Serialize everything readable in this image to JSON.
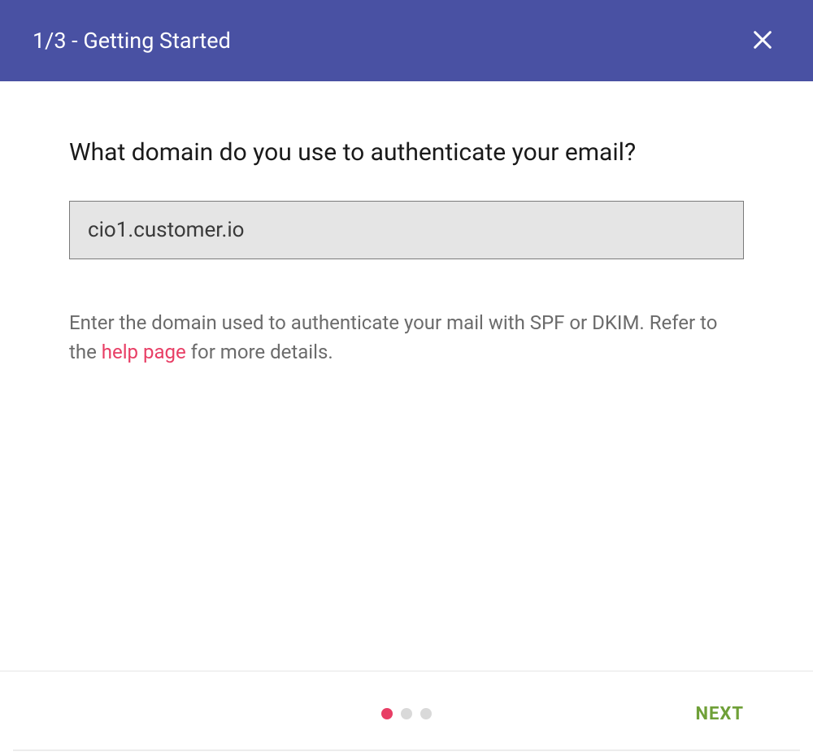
{
  "header": {
    "title": "1/3 - Getting Started"
  },
  "main": {
    "question": "What domain do you use to authenticate your email?",
    "domain_value": "cio1.customer.io",
    "helper_text_before": "Enter the domain used to authenticate your mail with SPF or DKIM. Refer to the ",
    "help_link_text": "help page",
    "helper_text_after": " for more details."
  },
  "footer": {
    "next_label": "NEXT",
    "step_count": 3,
    "active_step": 1
  },
  "colors": {
    "header_bg": "#4951a3",
    "accent": "#e83e65",
    "next_btn": "#6fa038"
  }
}
